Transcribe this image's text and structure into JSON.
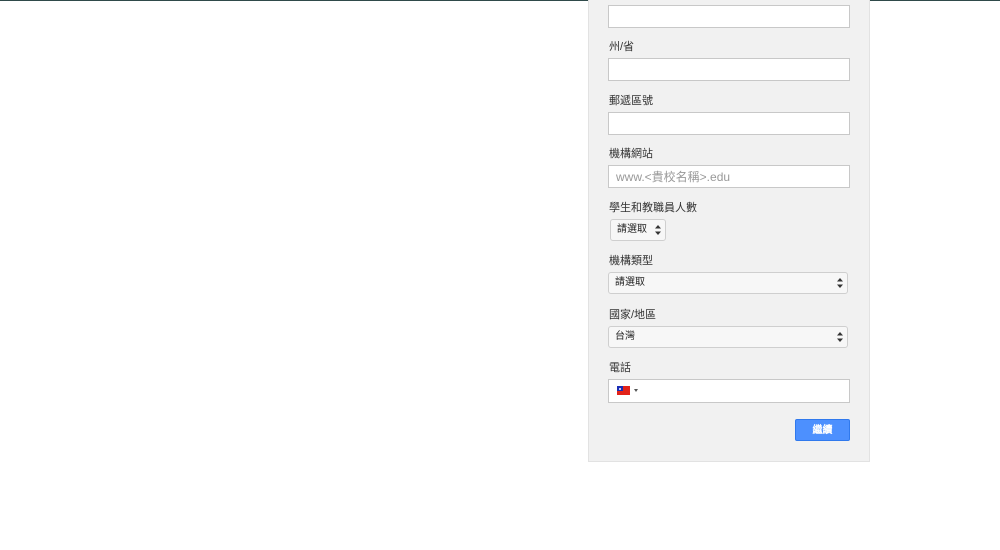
{
  "form": {
    "address_line_value": "",
    "state_label": "州/省",
    "state_value": "",
    "postal_label": "郵遞區號",
    "postal_value": "",
    "website_label": "機構網站",
    "website_placeholder": "www.<貴校名稱>.edu",
    "population_label": "學生和教職員人數",
    "population_selected": "請選取",
    "org_type_label": "機構類型",
    "org_type_selected": "請選取",
    "country_label": "國家/地區",
    "country_selected": "台灣",
    "phone_label": "電話",
    "phone_value": "",
    "phone_flag_icon": "taiwan-flag-icon",
    "continue_label": "繼續"
  },
  "colors": {
    "accent": "#4d90fe",
    "card_background": "#f1f1f1",
    "flag_red": "#e2231a",
    "flag_blue": "#1a2db5"
  }
}
